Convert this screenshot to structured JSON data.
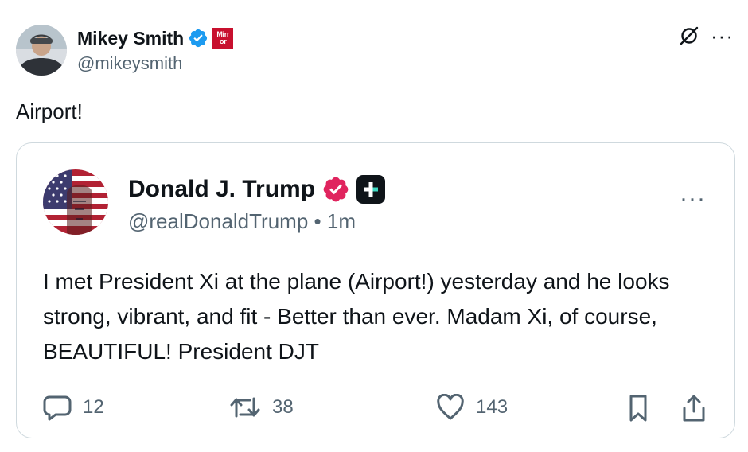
{
  "author": {
    "name": "Mikey Smith",
    "handle": "@mikeysmith",
    "affiliate_logo_text": "Mirror",
    "verified": true
  },
  "top_actions": {
    "grok_icon": "grok-icon",
    "more_label": "···"
  },
  "post_text": "Airport!",
  "quoted": {
    "name": "Donald J. Trump",
    "handle": "@realDonaldTrump",
    "separator": "•",
    "time": "1m",
    "more_label": "···",
    "body": "I met President Xi at the plane (Airport!) yesterday and he looks strong, vibrant, and fit - Better than ever. Madam Xi, of course, BEAUTIFUL! President DJT",
    "stats": {
      "replies": "12",
      "reposts": "38",
      "likes": "143"
    }
  },
  "colors": {
    "verified_blue": "#1d9bf0",
    "verified_pink": "#e0245e",
    "text_secondary": "#536471",
    "border": "#cfd9de",
    "mirror_red": "#c8102e"
  }
}
